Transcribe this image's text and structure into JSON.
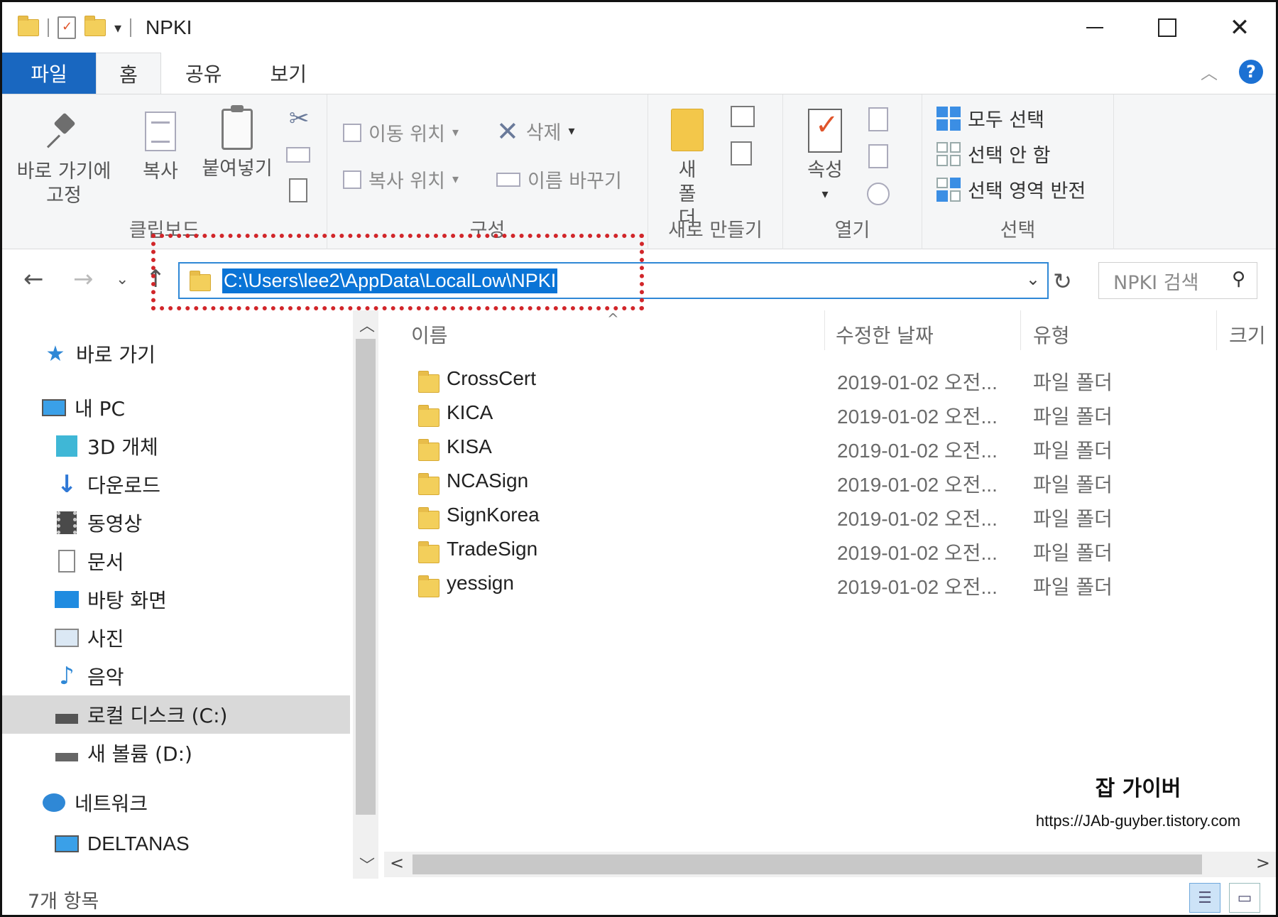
{
  "window": {
    "title": "NPKI",
    "minimize": "",
    "maximize": "",
    "close": "✕"
  },
  "tabs": [
    {
      "label": "파일"
    },
    {
      "label": "홈"
    },
    {
      "label": "공유"
    },
    {
      "label": "보기"
    }
  ],
  "ribbon": {
    "clipboard": {
      "pin_label": "바로 가기에 고정",
      "copy_label": "복사",
      "paste_label": "붙여넣기",
      "group_label": "클립보드"
    },
    "organize": {
      "move_to": "이동 위치",
      "copy_to": "복사 위치",
      "delete": "삭제",
      "rename": "이름 바꾸기",
      "group_label": "구성"
    },
    "new": {
      "new_folder": "새 폴더",
      "group_label": "새로 만들기"
    },
    "open": {
      "properties": "속성",
      "group_label": "열기"
    },
    "select": {
      "select_all": "모두 선택",
      "select_none": "선택 안 함",
      "invert": "선택 영역 반전",
      "group_label": "선택"
    }
  },
  "address": {
    "path": "C:\\Users\\lee2\\AppData\\LocalLow\\NPKI",
    "search_placeholder": "NPKI 검색"
  },
  "sidebar": {
    "items": [
      {
        "label": "바로 가기",
        "icon": "star-icon"
      },
      {
        "label": "내 PC",
        "icon": "computer-icon"
      },
      {
        "label": "3D 개체",
        "icon": "cube-icon"
      },
      {
        "label": "다운로드",
        "icon": "download-icon"
      },
      {
        "label": "동영상",
        "icon": "film-icon"
      },
      {
        "label": "문서",
        "icon": "document-icon"
      },
      {
        "label": "바탕 화면",
        "icon": "desktop-icon"
      },
      {
        "label": "사진",
        "icon": "picture-icon"
      },
      {
        "label": "음악",
        "icon": "music-icon"
      },
      {
        "label": "로컬 디스크 (C:)",
        "icon": "drive-icon"
      },
      {
        "label": "새 볼륨 (D:)",
        "icon": "drive-icon"
      },
      {
        "label": "네트워크",
        "icon": "network-icon"
      },
      {
        "label": "DELTANAS",
        "icon": "computer-icon"
      }
    ]
  },
  "columns": {
    "name": "이름",
    "modified": "수정한 날짜",
    "type": "유형",
    "size": "크기"
  },
  "files": [
    {
      "name": "CrossCert",
      "modified": "2019-01-02 오전...",
      "type": "파일 폴더"
    },
    {
      "name": "KICA",
      "modified": "2019-01-02 오전...",
      "type": "파일 폴더"
    },
    {
      "name": "KISA",
      "modified": "2019-01-02 오전...",
      "type": "파일 폴더"
    },
    {
      "name": "NCASign",
      "modified": "2019-01-02 오전...",
      "type": "파일 폴더"
    },
    {
      "name": "SignKorea",
      "modified": "2019-01-02 오전...",
      "type": "파일 폴더"
    },
    {
      "name": "TradeSign",
      "modified": "2019-01-02 오전...",
      "type": "파일 폴더"
    },
    {
      "name": "yessign",
      "modified": "2019-01-02 오전...",
      "type": "파일 폴더"
    }
  ],
  "status": {
    "count": "7개 항목"
  },
  "watermark": {
    "title": "잡 가이버",
    "url": "https://JAb-guyber.tistory.com"
  },
  "colors": {
    "accent": "#1967c0",
    "selection": "#0a74d6",
    "annotation": "#d1262a",
    "folder": "#f3cf5b"
  }
}
